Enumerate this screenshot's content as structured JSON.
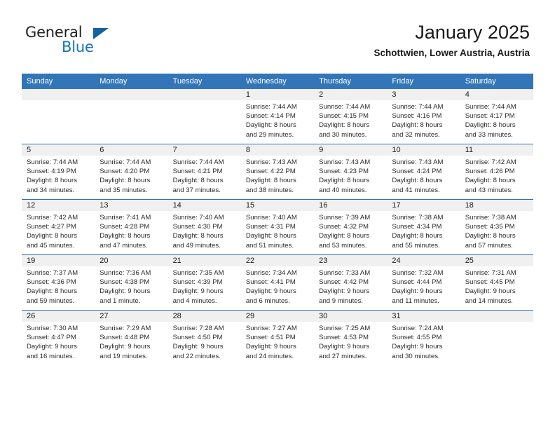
{
  "brand": {
    "word_general": "General",
    "word_blue": "Blue"
  },
  "header": {
    "title": "January 2025",
    "subtitle": "Schottwien, Lower Austria, Austria"
  },
  "colors": {
    "header_blue": "#3276b9",
    "row_divider_blue": "#2f6fb0",
    "daynum_band": "#f0f0f0",
    "logo_blue": "#1273c4",
    "logo_triangle": "#14619f"
  },
  "weekday_headers": [
    "Sunday",
    "Monday",
    "Tuesday",
    "Wednesday",
    "Thursday",
    "Friday",
    "Saturday"
  ],
  "weeks": [
    [
      {
        "day": "",
        "lines": []
      },
      {
        "day": "",
        "lines": []
      },
      {
        "day": "",
        "lines": []
      },
      {
        "day": "1",
        "lines": [
          "Sunrise: 7:44 AM",
          "Sunset: 4:14 PM",
          "Daylight: 8 hours",
          "and 29 minutes."
        ]
      },
      {
        "day": "2",
        "lines": [
          "Sunrise: 7:44 AM",
          "Sunset: 4:15 PM",
          "Daylight: 8 hours",
          "and 30 minutes."
        ]
      },
      {
        "day": "3",
        "lines": [
          "Sunrise: 7:44 AM",
          "Sunset: 4:16 PM",
          "Daylight: 8 hours",
          "and 32 minutes."
        ]
      },
      {
        "day": "4",
        "lines": [
          "Sunrise: 7:44 AM",
          "Sunset: 4:17 PM",
          "Daylight: 8 hours",
          "and 33 minutes."
        ]
      }
    ],
    [
      {
        "day": "5",
        "lines": [
          "Sunrise: 7:44 AM",
          "Sunset: 4:19 PM",
          "Daylight: 8 hours",
          "and 34 minutes."
        ]
      },
      {
        "day": "6",
        "lines": [
          "Sunrise: 7:44 AM",
          "Sunset: 4:20 PM",
          "Daylight: 8 hours",
          "and 35 minutes."
        ]
      },
      {
        "day": "7",
        "lines": [
          "Sunrise: 7:44 AM",
          "Sunset: 4:21 PM",
          "Daylight: 8 hours",
          "and 37 minutes."
        ]
      },
      {
        "day": "8",
        "lines": [
          "Sunrise: 7:43 AM",
          "Sunset: 4:22 PM",
          "Daylight: 8 hours",
          "and 38 minutes."
        ]
      },
      {
        "day": "9",
        "lines": [
          "Sunrise: 7:43 AM",
          "Sunset: 4:23 PM",
          "Daylight: 8 hours",
          "and 40 minutes."
        ]
      },
      {
        "day": "10",
        "lines": [
          "Sunrise: 7:43 AM",
          "Sunset: 4:24 PM",
          "Daylight: 8 hours",
          "and 41 minutes."
        ]
      },
      {
        "day": "11",
        "lines": [
          "Sunrise: 7:42 AM",
          "Sunset: 4:26 PM",
          "Daylight: 8 hours",
          "and 43 minutes."
        ]
      }
    ],
    [
      {
        "day": "12",
        "lines": [
          "Sunrise: 7:42 AM",
          "Sunset: 4:27 PM",
          "Daylight: 8 hours",
          "and 45 minutes."
        ]
      },
      {
        "day": "13",
        "lines": [
          "Sunrise: 7:41 AM",
          "Sunset: 4:28 PM",
          "Daylight: 8 hours",
          "and 47 minutes."
        ]
      },
      {
        "day": "14",
        "lines": [
          "Sunrise: 7:40 AM",
          "Sunset: 4:30 PM",
          "Daylight: 8 hours",
          "and 49 minutes."
        ]
      },
      {
        "day": "15",
        "lines": [
          "Sunrise: 7:40 AM",
          "Sunset: 4:31 PM",
          "Daylight: 8 hours",
          "and 51 minutes."
        ]
      },
      {
        "day": "16",
        "lines": [
          "Sunrise: 7:39 AM",
          "Sunset: 4:32 PM",
          "Daylight: 8 hours",
          "and 53 minutes."
        ]
      },
      {
        "day": "17",
        "lines": [
          "Sunrise: 7:38 AM",
          "Sunset: 4:34 PM",
          "Daylight: 8 hours",
          "and 55 minutes."
        ]
      },
      {
        "day": "18",
        "lines": [
          "Sunrise: 7:38 AM",
          "Sunset: 4:35 PM",
          "Daylight: 8 hours",
          "and 57 minutes."
        ]
      }
    ],
    [
      {
        "day": "19",
        "lines": [
          "Sunrise: 7:37 AM",
          "Sunset: 4:36 PM",
          "Daylight: 8 hours",
          "and 59 minutes."
        ]
      },
      {
        "day": "20",
        "lines": [
          "Sunrise: 7:36 AM",
          "Sunset: 4:38 PM",
          "Daylight: 9 hours",
          "and 1 minute."
        ]
      },
      {
        "day": "21",
        "lines": [
          "Sunrise: 7:35 AM",
          "Sunset: 4:39 PM",
          "Daylight: 9 hours",
          "and 4 minutes."
        ]
      },
      {
        "day": "22",
        "lines": [
          "Sunrise: 7:34 AM",
          "Sunset: 4:41 PM",
          "Daylight: 9 hours",
          "and 6 minutes."
        ]
      },
      {
        "day": "23",
        "lines": [
          "Sunrise: 7:33 AM",
          "Sunset: 4:42 PM",
          "Daylight: 9 hours",
          "and 9 minutes."
        ]
      },
      {
        "day": "24",
        "lines": [
          "Sunrise: 7:32 AM",
          "Sunset: 4:44 PM",
          "Daylight: 9 hours",
          "and 11 minutes."
        ]
      },
      {
        "day": "25",
        "lines": [
          "Sunrise: 7:31 AM",
          "Sunset: 4:45 PM",
          "Daylight: 9 hours",
          "and 14 minutes."
        ]
      }
    ],
    [
      {
        "day": "26",
        "lines": [
          "Sunrise: 7:30 AM",
          "Sunset: 4:47 PM",
          "Daylight: 9 hours",
          "and 16 minutes."
        ]
      },
      {
        "day": "27",
        "lines": [
          "Sunrise: 7:29 AM",
          "Sunset: 4:48 PM",
          "Daylight: 9 hours",
          "and 19 minutes."
        ]
      },
      {
        "day": "28",
        "lines": [
          "Sunrise: 7:28 AM",
          "Sunset: 4:50 PM",
          "Daylight: 9 hours",
          "and 22 minutes."
        ]
      },
      {
        "day": "29",
        "lines": [
          "Sunrise: 7:27 AM",
          "Sunset: 4:51 PM",
          "Daylight: 9 hours",
          "and 24 minutes."
        ]
      },
      {
        "day": "30",
        "lines": [
          "Sunrise: 7:25 AM",
          "Sunset: 4:53 PM",
          "Daylight: 9 hours",
          "and 27 minutes."
        ]
      },
      {
        "day": "31",
        "lines": [
          "Sunrise: 7:24 AM",
          "Sunset: 4:55 PM",
          "Daylight: 9 hours",
          "and 30 minutes."
        ]
      },
      {
        "day": "",
        "lines": []
      }
    ]
  ]
}
